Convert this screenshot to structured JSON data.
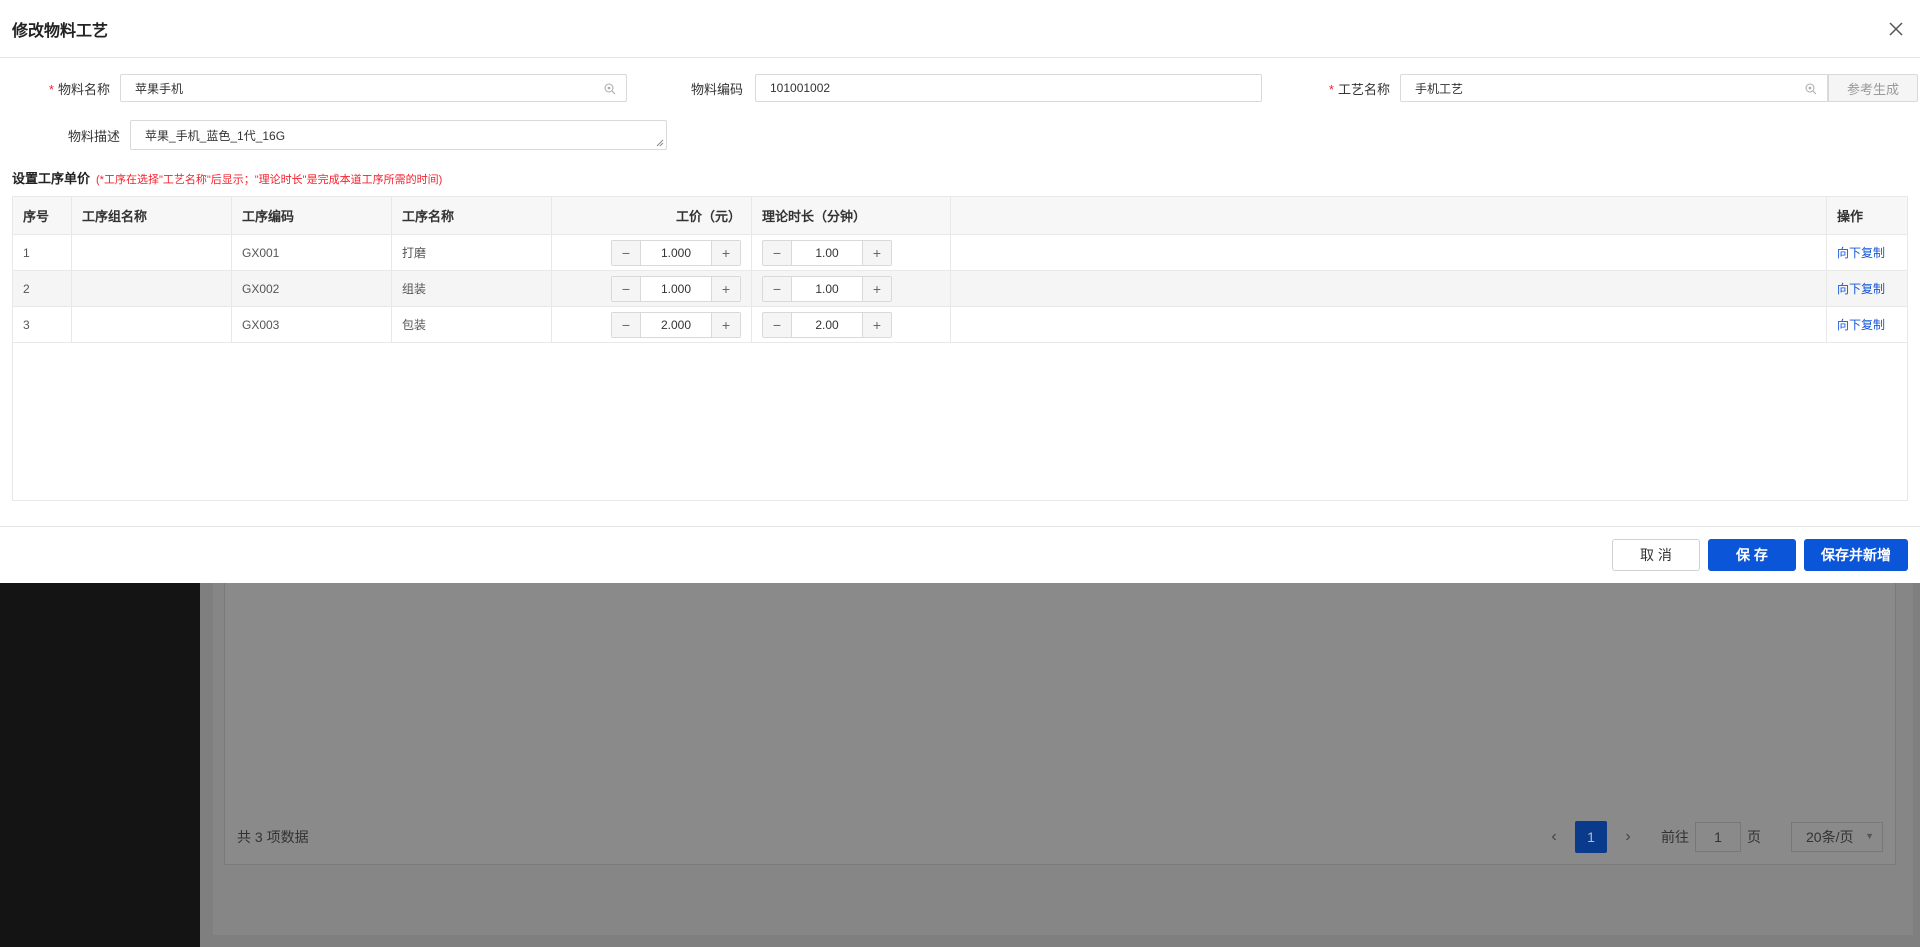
{
  "modal": {
    "title": "修改物料工艺",
    "fields": {
      "material_name_label": "物料名称",
      "material_name_value": "苹果手机",
      "material_code_label": "物料编码",
      "material_code_value": "101001002",
      "process_name_label": "工艺名称",
      "process_name_value": "手机工艺",
      "ref_button": "参考生成",
      "desc_label": "物料描述",
      "desc_value": "苹果_手机_蓝色_1代_16G"
    },
    "section": {
      "title": "设置工序单价",
      "note": "(*工序在选择\"工艺名称\"后显示；\"理论时长\"是完成本道工序所需的时间)"
    },
    "table": {
      "headers": [
        "序号",
        "工序组名称",
        "工序编码",
        "工序名称",
        "工价（元）",
        "理论时长（分钟）",
        "",
        "操作"
      ],
      "rows": [
        {
          "no": "1",
          "group": "",
          "code": "GX001",
          "name": "打磨",
          "price": "1.000",
          "duration": "1.00",
          "action": "向下复制"
        },
        {
          "no": "2",
          "group": "",
          "code": "GX002",
          "name": "组装",
          "price": "1.000",
          "duration": "1.00",
          "action": "向下复制"
        },
        {
          "no": "3",
          "group": "",
          "code": "GX003",
          "name": "包装",
          "price": "2.000",
          "duration": "2.00",
          "action": "向下复制"
        }
      ]
    },
    "footer": {
      "cancel": "取 消",
      "save": "保 存",
      "save_new": "保存并新增"
    }
  },
  "background": {
    "total": "共 3 项数据",
    "current_page": "1",
    "goto_label": "前往",
    "goto_value": "1",
    "page_unit": "页",
    "page_size": "20条/页"
  }
}
